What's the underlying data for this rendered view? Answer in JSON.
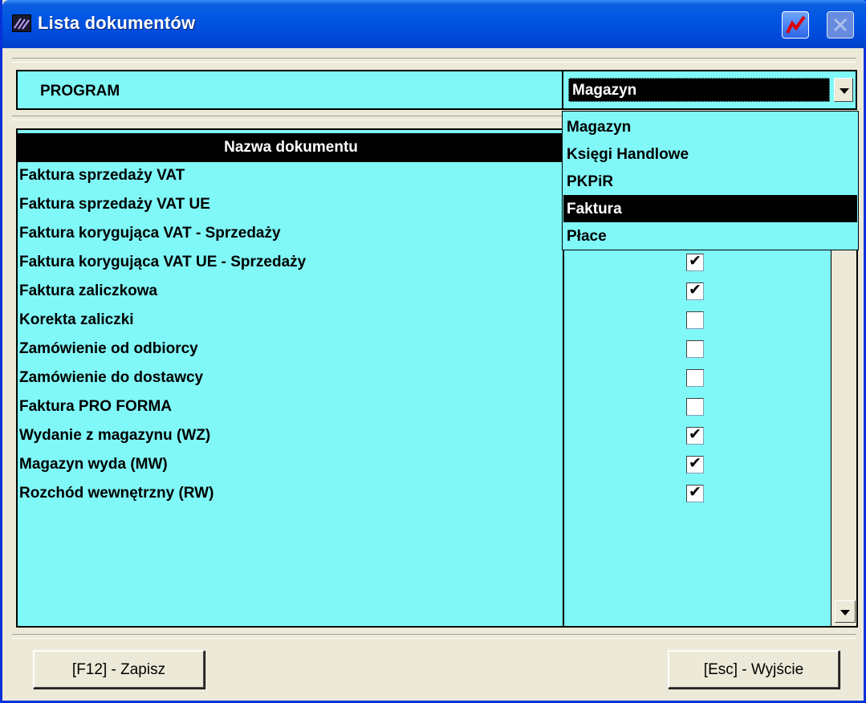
{
  "window": {
    "title": "Lista dokumentów"
  },
  "program": {
    "label": "PROGRAM",
    "selected": "Magazyn",
    "options": [
      "Magazyn",
      "Księgi Handlowe",
      "PKPiR",
      "Faktura",
      "Płace"
    ],
    "highlighted_option": "Faktura"
  },
  "grid": {
    "header": "Nazwa dokumentu",
    "rows": [
      {
        "name": "Faktura sprzedaży VAT",
        "checked": null
      },
      {
        "name": "Faktura sprzedaży VAT UE",
        "checked": null
      },
      {
        "name": "Faktura korygująca VAT - Sprzedaży",
        "checked": null
      },
      {
        "name": "Faktura korygująca VAT UE - Sprzedaży",
        "checked": true
      },
      {
        "name": "Faktura zaliczkowa",
        "checked": true
      },
      {
        "name": "Korekta zaliczki",
        "checked": false
      },
      {
        "name": "Zamówienie od odbiorcy",
        "checked": false
      },
      {
        "name": "Zamówienie do dostawcy",
        "checked": false
      },
      {
        "name": "Faktura PRO FORMA",
        "checked": false
      },
      {
        "name": "Wydanie z magazynu (WZ)",
        "checked": true
      },
      {
        "name": "Magazyn wyda (MW)",
        "checked": true
      },
      {
        "name": "Rozchód wewnętrzny (RW)",
        "checked": true
      }
    ]
  },
  "footer": {
    "save_label": "[F12] - Zapisz",
    "exit_label": "[Esc] - Wyjście"
  },
  "colors": {
    "panel": "#80F8F8",
    "titlebar": "#0054E3",
    "selection": "#000000"
  },
  "icons": {
    "app": "app-logo-icon",
    "special": "chart-icon",
    "close": "close-icon",
    "dropdown": "chevron-down-icon",
    "scroll_down": "scroll-down-arrow-icon",
    "check": "check-icon"
  }
}
